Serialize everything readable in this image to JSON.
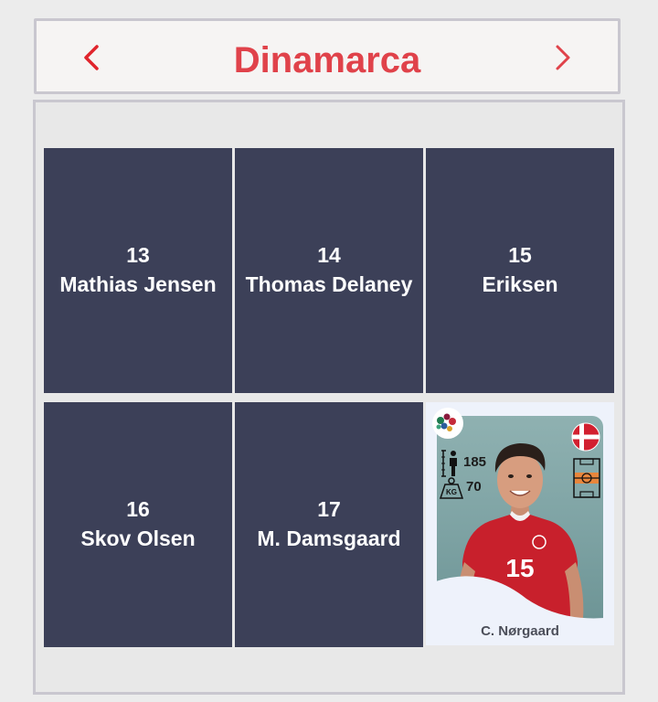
{
  "header": {
    "title": "Dinamarca",
    "prev_icon": "chevron-left-icon",
    "next_icon": "chevron-right-icon",
    "accent_color": "#e0424a"
  },
  "players": [
    {
      "number": "13",
      "name": "Mathias Jensen"
    },
    {
      "number": "14",
      "name": "Thomas Delaney"
    },
    {
      "number": "15",
      "name": "Eriksen"
    },
    {
      "number": "16",
      "name": "Skov Olsen"
    },
    {
      "number": "17",
      "name": "M. Damsgaard"
    }
  ],
  "featured": {
    "name": "C. Nørgaard",
    "height": "185",
    "weight": "70",
    "weight_icon_label": "KG",
    "shirt_number": "15",
    "icons": [
      "tournament-logo-icon",
      "denmark-flag-icon",
      "height-icon",
      "weight-icon",
      "field-position-icon"
    ]
  },
  "colors": {
    "card_bg": "#3c4058",
    "card_text": "#ffffff",
    "page_bg": "#ececec"
  }
}
